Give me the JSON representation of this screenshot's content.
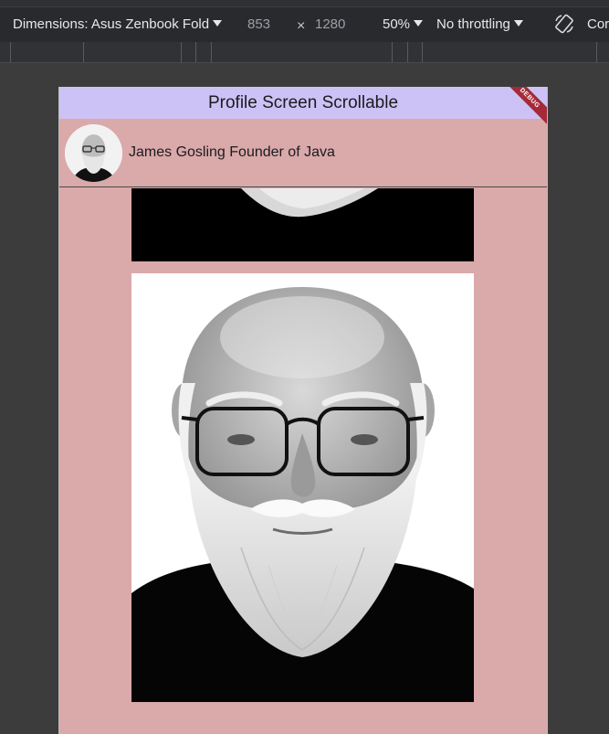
{
  "devtools": {
    "dimensions_label": "Dimensions: Asus Zenbook Fold",
    "width": "853",
    "times_symbol": "×",
    "height": "1280",
    "zoom": "50%",
    "throttling": "No throttling",
    "truncated_label": "Cor"
  },
  "app": {
    "title": "Profile Screen Scrollable",
    "debug_banner": "DEBUG",
    "profile_name": "James Gosling Founder of Java"
  }
}
